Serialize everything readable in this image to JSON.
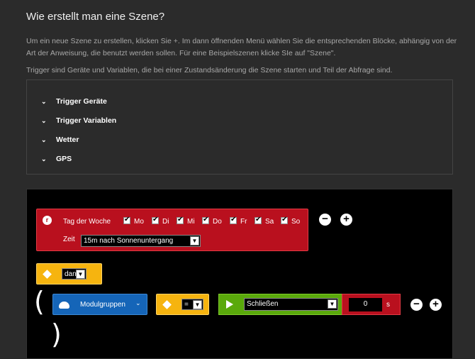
{
  "header": {
    "title": "Wie erstellt man eine Szene?",
    "intro": "Um ein neue Szene zu erstellen, klicken Sie +. Im dann öffnenden Menü wählen Sie die entsprechenden Blöcke, abhängig von der Art der Anweisung, die benutzt werden sollen. Für eine Beispielszenen klicke SIe auf \"Szene\".",
    "trigger_info": "Trigger sind Geräte und Variablen, die bei einer Zustandsänderung die Szene starten und Teil der Abfrage sind."
  },
  "accordion": {
    "items": [
      {
        "label": "Trigger Geräte",
        "icon": "chevron-down-icon"
      },
      {
        "label": "Trigger Variablen",
        "icon": "chevron-down-icon"
      },
      {
        "label": "Wetter",
        "icon": "chevron-down-icon"
      },
      {
        "label": "GPS",
        "icon": "chevron-down-icon"
      }
    ]
  },
  "editor": {
    "time_block": {
      "day_label": "Tag der Woche",
      "days": [
        {
          "label": "Mo",
          "checked": true
        },
        {
          "label": "Di",
          "checked": true
        },
        {
          "label": "Mi",
          "checked": true
        },
        {
          "label": "Do",
          "checked": true
        },
        {
          "label": "Fr",
          "checked": true
        },
        {
          "label": "Sa",
          "checked": true
        },
        {
          "label": "So",
          "checked": true
        }
      ],
      "time_label": "Zeit",
      "time_value": "15m nach Sonnenuntergang",
      "color": "#b9101e"
    },
    "then_block": {
      "value": "dann",
      "color": "#f6b40f"
    },
    "action_row": {
      "open_paren": "(",
      "close_paren": ")",
      "group_button": "Modulgruppen",
      "operator": "=",
      "action_value": "Schließen",
      "delay_value": "0",
      "delay_unit": "s"
    }
  }
}
